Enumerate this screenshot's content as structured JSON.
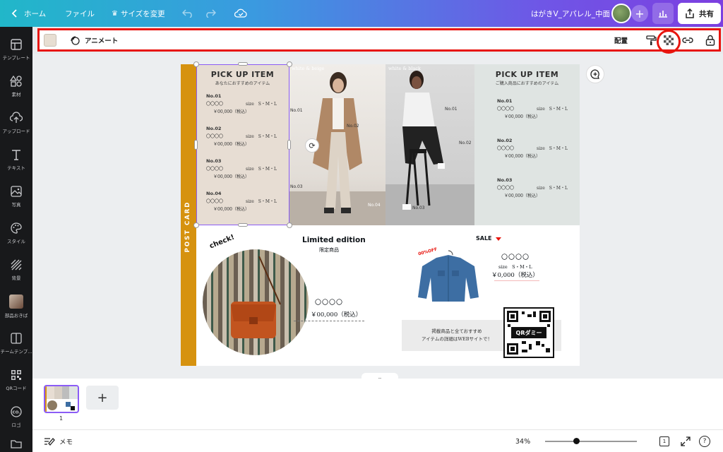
{
  "topbar": {
    "home": "ホーム",
    "file": "ファイル",
    "resize": "サイズを変更",
    "doc_title": "はがきV_アパレル_中面",
    "share": "共有"
  },
  "sidebar": {
    "items": [
      {
        "label": "テンプレート",
        "icon": "template-icon"
      },
      {
        "label": "素材",
        "icon": "elements-icon"
      },
      {
        "label": "アップロード",
        "icon": "upload-icon"
      },
      {
        "label": "テキスト",
        "icon": "text-icon"
      },
      {
        "label": "写真",
        "icon": "photo-icon"
      },
      {
        "label": "スタイル",
        "icon": "palette-icon"
      },
      {
        "label": "背景",
        "icon": "background-icon"
      },
      {
        "label": "部品おきば",
        "icon": "parts-icon"
      },
      {
        "label": "チームテンプ...",
        "icon": "team-template-icon"
      },
      {
        "label": "QRコード",
        "icon": "qr-icon"
      },
      {
        "label": "ロゴ",
        "icon": "logo-icon"
      }
    ]
  },
  "toolbar": {
    "animate": "アニメート",
    "position": "配置",
    "swatch_color": "#e7ded2",
    "highlight_color": "#e8150e"
  },
  "design": {
    "band_text": "POST CARD",
    "left_panel": {
      "title": "PICK UP ITEM",
      "subtitle": "あなたにおすすめのアイテム",
      "items": [
        {
          "no": "No.01",
          "name": "〇〇〇〇",
          "size": "size　S・M・L",
          "price": "￥00,000（税込）"
        },
        {
          "no": "No.02",
          "name": "〇〇〇〇",
          "size": "size　S・M・L",
          "price": "￥00,000（税込）"
        },
        {
          "no": "No.03",
          "name": "〇〇〇〇",
          "size": "size　S・M・L",
          "price": "￥00,000（税込）"
        },
        {
          "no": "No.04",
          "name": "〇〇〇〇",
          "size": "size　S・M・L",
          "price": "￥00,000（税込）"
        }
      ]
    },
    "photo1": {
      "tag": "white & beige",
      "labels": [
        "No.01",
        "No.02",
        "No.03",
        "No.04"
      ]
    },
    "photo2": {
      "tag": "white & black",
      "labels": [
        "No.01",
        "No.02",
        "No.03"
      ]
    },
    "right_panel": {
      "title": "PICK UP ITEM",
      "subtitle": "ご購入商品におすすめのアイテム",
      "items": [
        {
          "no": "No.01",
          "name": "〇〇〇〇",
          "size": "size　S・M・L",
          "price": "￥00,000（税込）"
        },
        {
          "no": "No.02",
          "name": "〇〇〇〇",
          "size": "size　S・M・L",
          "price": "￥00,000（税込）"
        },
        {
          "no": "No.03",
          "name": "〇〇〇〇",
          "size": "size　S・M・L",
          "price": "￥00,000（税込）"
        }
      ]
    },
    "check": "check!",
    "limited_title": "Limited edition",
    "limited_sub": "限定商品",
    "bag_name": "〇〇〇〇",
    "bag_price": "￥00,000（税込）",
    "sale": "SALE",
    "off_badge": "00%OFF",
    "jacket_name": "〇〇〇〇",
    "jacket_size": "size　S・M・L",
    "jacket_price": "￥0,000（税込）",
    "info_line1": "掲載商品と全ておすすめ",
    "info_line2": "アイテムの詳細はWEBサイトで！",
    "qr_label": "QRダミー"
  },
  "pages": {
    "current": "1"
  },
  "footer": {
    "notes": "メモ",
    "zoom": "34%",
    "zoom_level": 0.34,
    "page_count": "1",
    "help": "?"
  }
}
